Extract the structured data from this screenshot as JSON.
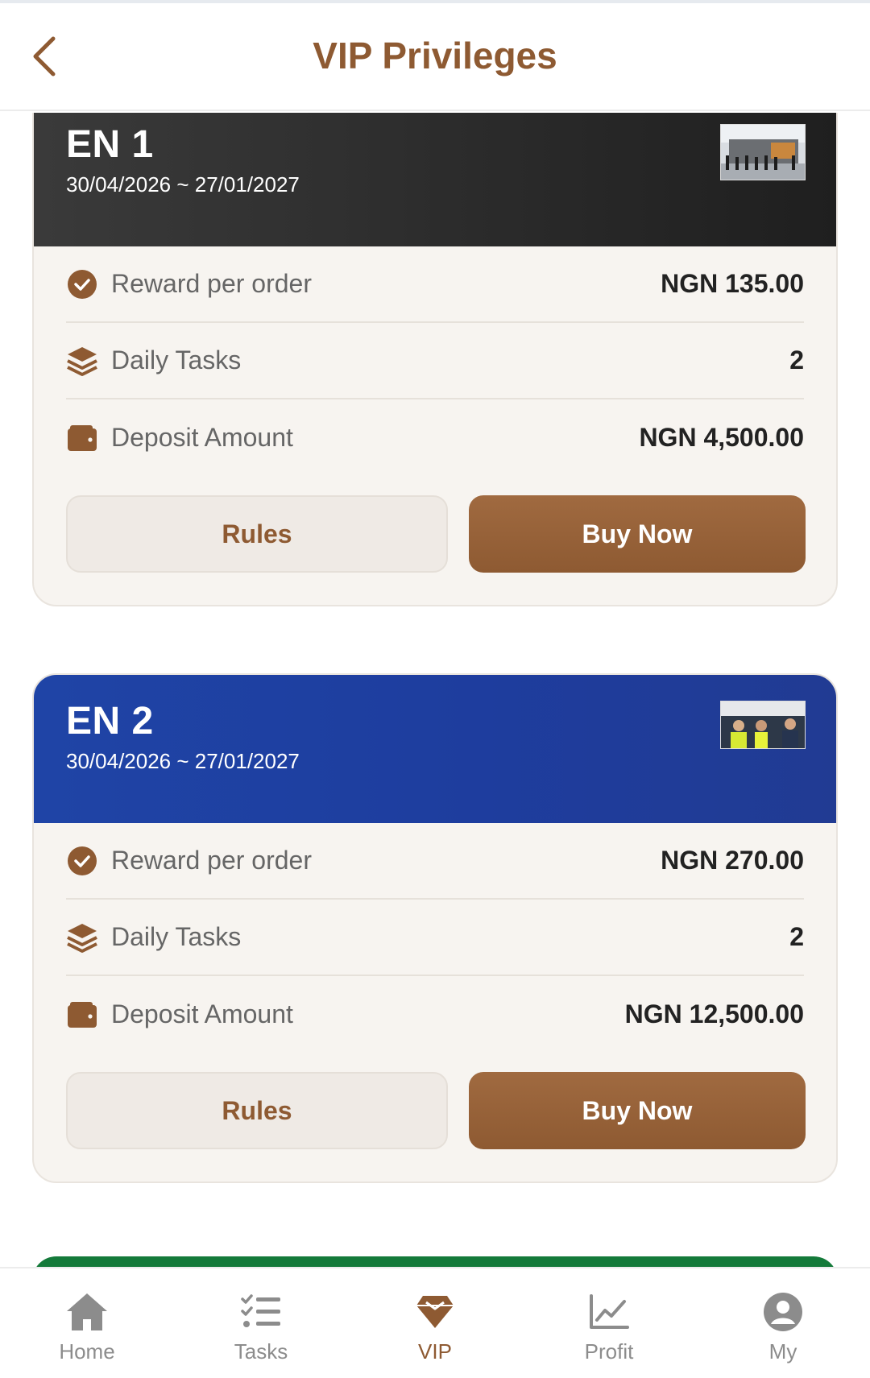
{
  "header": {
    "title": "VIP Privileges",
    "back_icon": "chevron-left-icon"
  },
  "colors": {
    "brand": "#8e5a32",
    "card_bg": "#f7f4f0",
    "dark_header": "#2b2b2b",
    "blue_header": "#1e3d9e",
    "green_header": "#147a3a"
  },
  "cards": [
    {
      "level": "EN 1",
      "dates": "30/04/2026 ~ 27/01/2027",
      "rows": [
        {
          "icon": "check-circle-icon",
          "label": "Reward per order",
          "value": "NGN 135.00"
        },
        {
          "icon": "layers-icon",
          "label": "Daily Tasks",
          "value": "2"
        },
        {
          "icon": "wallet-icon",
          "label": "Deposit Amount",
          "value": "NGN 4,500.00"
        }
      ],
      "rules_label": "Rules",
      "buy_label": "Buy Now"
    },
    {
      "level": "EN 2",
      "dates": "30/04/2026 ~ 27/01/2027",
      "rows": [
        {
          "icon": "check-circle-icon",
          "label": "Reward per order",
          "value": "NGN 270.00"
        },
        {
          "icon": "layers-icon",
          "label": "Daily Tasks",
          "value": "2"
        },
        {
          "icon": "wallet-icon",
          "label": "Deposit Amount",
          "value": "NGN 12,500.00"
        }
      ],
      "rules_label": "Rules",
      "buy_label": "Buy Now"
    }
  ],
  "tabbar": {
    "active": "VIP",
    "items": [
      {
        "label": "Home",
        "icon": "home-icon"
      },
      {
        "label": "Tasks",
        "icon": "tasks-list-icon"
      },
      {
        "label": "VIP",
        "icon": "diamond-icon"
      },
      {
        "label": "Profit",
        "icon": "line-chart-icon"
      },
      {
        "label": "My",
        "icon": "user-circle-icon"
      }
    ]
  }
}
